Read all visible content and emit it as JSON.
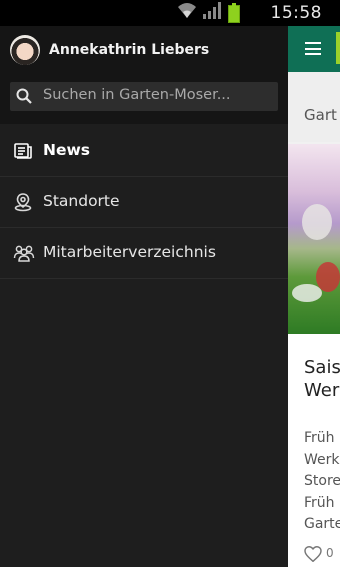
{
  "status_bar": {
    "time": "15:58",
    "icons": [
      "wifi-icon",
      "signal-icon",
      "battery-icon"
    ],
    "battery_color": "#8ed11e"
  },
  "drawer": {
    "user_name": "Annekathrin Liebers",
    "search": {
      "placeholder": "Suchen in Garten-Moser..."
    },
    "items": [
      {
        "label": "News",
        "icon": "news-icon",
        "active": true
      },
      {
        "label": "Standorte",
        "icon": "location-icon",
        "active": false
      },
      {
        "label": "Mitarbeiterverzeichnis",
        "icon": "people-icon",
        "active": false
      }
    ],
    "colors": {
      "background": "#1e1e1e",
      "header": "#151515",
      "text": "#e6e6e6"
    }
  },
  "background_app": {
    "toolbar_color": "#0f6f55",
    "accent_color": "#9bd12a",
    "subheader_fragment": "Gart",
    "card": {
      "title_fragment": "Sais\nWer",
      "text_fragment": "Früh\nWerk\nStore\nFrüh\nGarte",
      "likes_fragment": "0"
    }
  }
}
